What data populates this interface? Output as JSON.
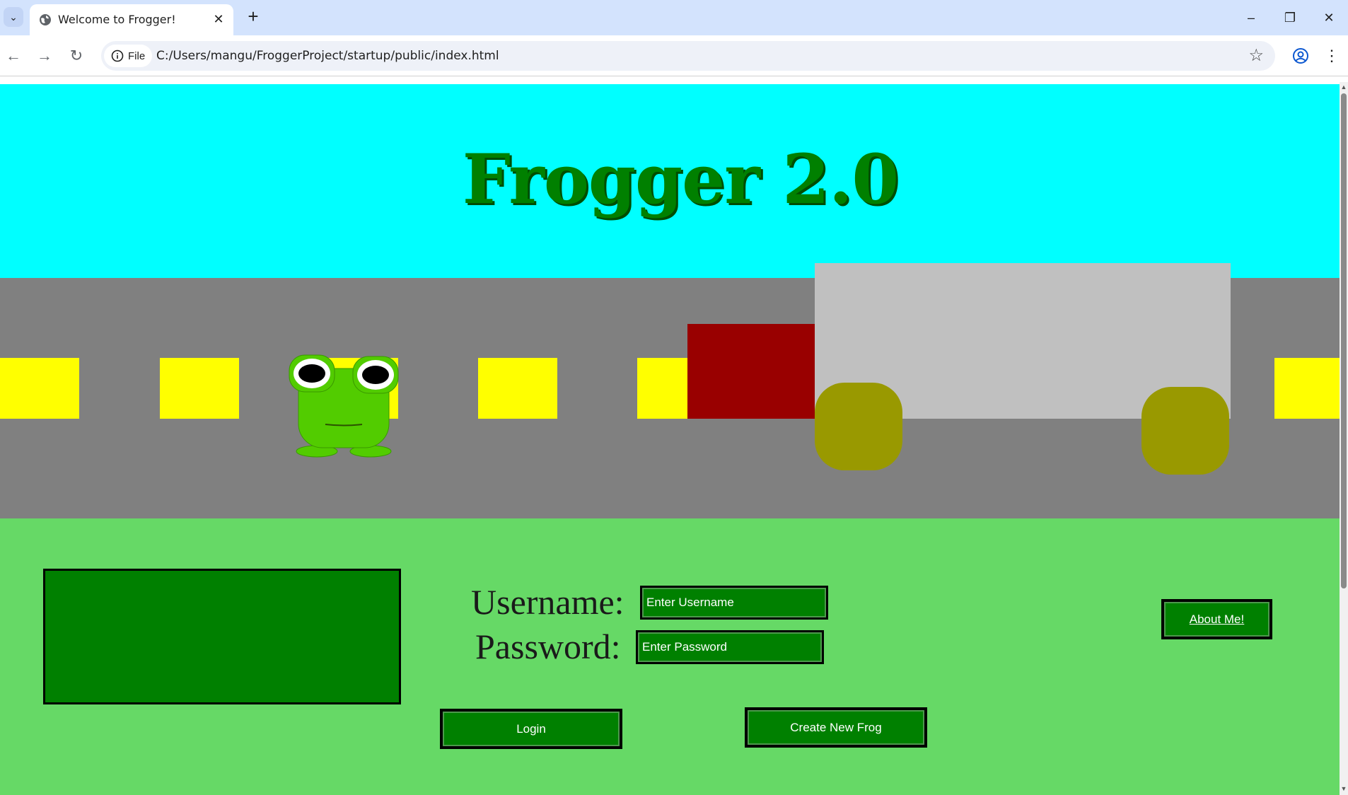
{
  "browser": {
    "tab_title": "Welcome to Frogger!",
    "site_chip_label": "File",
    "url": "C:/Users/mangu/FroggerProject/startup/public/index.html",
    "icons": [
      "tab-search-icon",
      "globe-icon",
      "close-icon",
      "plus-icon",
      "minimize-icon",
      "restore-icon",
      "window-close-icon",
      "back-icon",
      "forward-icon",
      "reload-icon",
      "info-icon",
      "star-icon",
      "profile-icon",
      "menu-icon"
    ]
  },
  "page": {
    "title": "Frogger 2.0",
    "colors": {
      "sky": "#00ffff",
      "road": "#808080",
      "lane_marks": "#ffff00",
      "grass": "#66d966",
      "panel": "#008000",
      "truck_cab": "#990000",
      "truck_trailer": "#c0c0c0",
      "wheels": "#999900",
      "frog": "#52cc00"
    },
    "form": {
      "username_label": "Username:",
      "username_placeholder": "Enter Username",
      "password_label": "Password:",
      "password_placeholder": "Enter Password",
      "login_label": "Login",
      "create_label": "Create New Frog"
    },
    "about_label": "About Me!"
  }
}
